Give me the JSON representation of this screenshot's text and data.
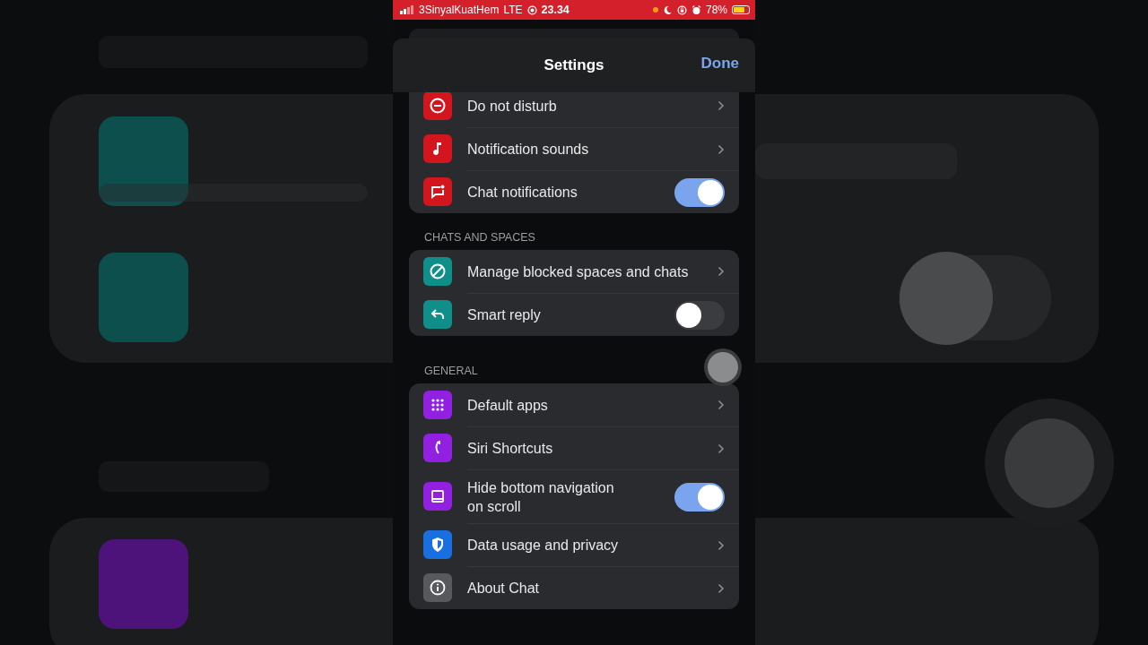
{
  "status_bar": {
    "carrier": "3SinyalKuatHem",
    "network": "LTE",
    "time": "23.34",
    "battery": "78%"
  },
  "header": {
    "title": "Settings",
    "done": "Done"
  },
  "sections": [
    {
      "rows": [
        {
          "kind": "link",
          "label": "Do not disturb",
          "color": "#d3161d"
        },
        {
          "kind": "link",
          "label": "Notification sounds",
          "color": "#d3161d"
        },
        {
          "kind": "toggle",
          "label": "Chat notifications",
          "color": "#d3161d",
          "on": true
        }
      ]
    },
    {
      "title": "CHATS AND SPACES",
      "rows": [
        {
          "kind": "link",
          "label": "Manage blocked spaces and chats",
          "color": "#108f8a"
        },
        {
          "kind": "toggle",
          "label": "Smart reply",
          "color": "#108f8a",
          "on": false
        }
      ]
    },
    {
      "title": "GENERAL",
      "rows": [
        {
          "kind": "link",
          "label": "Default apps",
          "color": "#9120e0"
        },
        {
          "kind": "link",
          "label": "Siri Shortcuts",
          "color": "#9120e0"
        },
        {
          "kind": "toggle",
          "label": "Hide bottom navigation on scroll",
          "color": "#9120e0",
          "on": true
        },
        {
          "kind": "link",
          "label": "Data usage and privacy",
          "color": "#1a6fe0"
        },
        {
          "kind": "link",
          "label": "About Chat",
          "color": "#58595c"
        }
      ]
    }
  ]
}
